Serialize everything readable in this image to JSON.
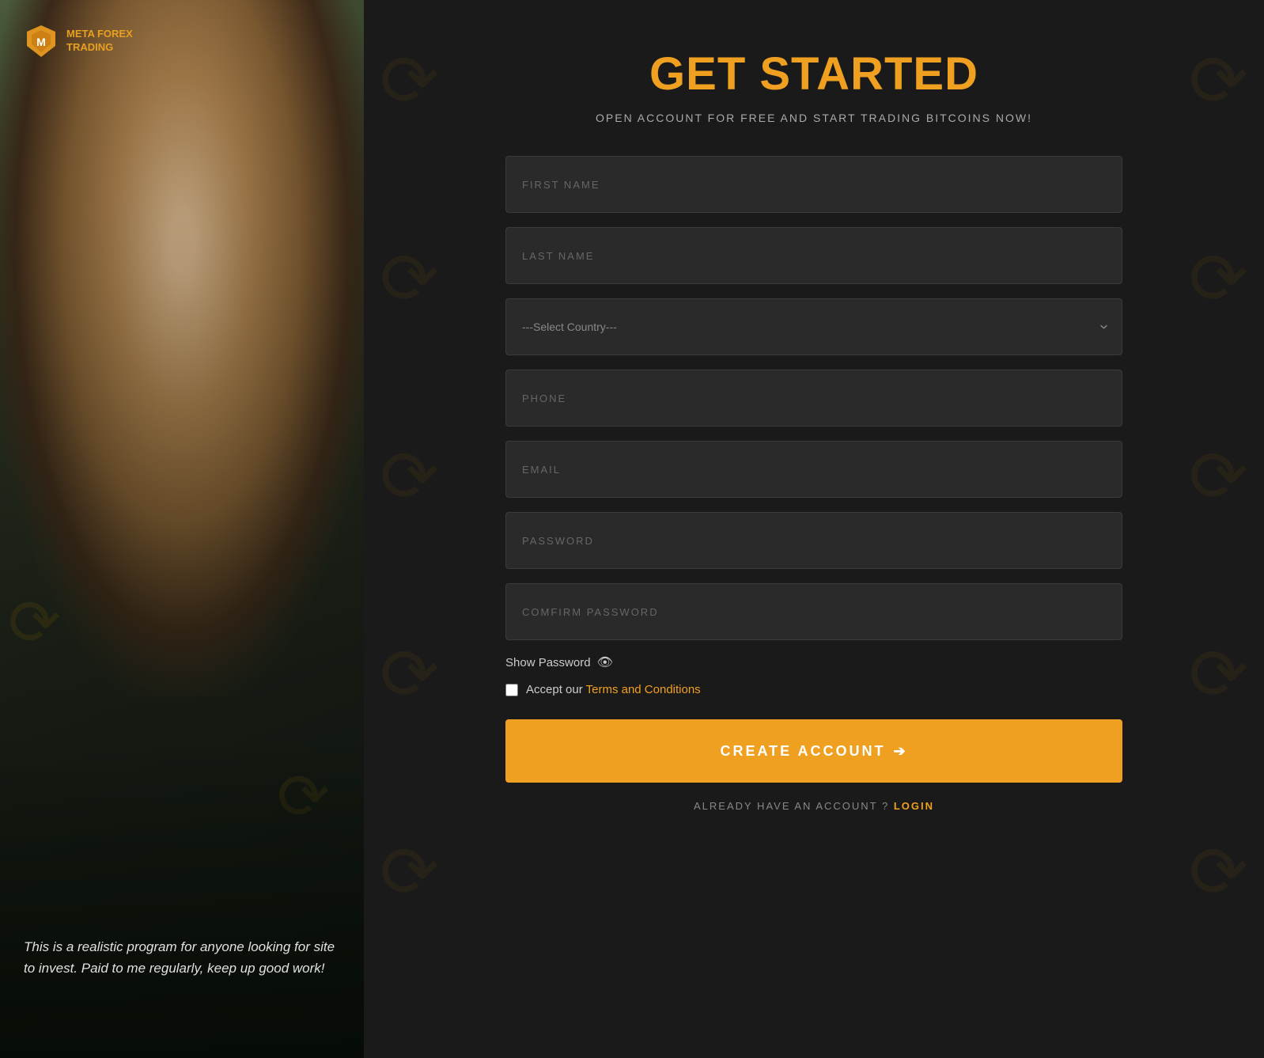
{
  "brand": {
    "name_line1": "META FOREX",
    "name_line2": "TRADING"
  },
  "hero": {
    "title_white": "GET",
    "title_orange": "STARTED",
    "subtitle": "OPEN ACCOUNT FOR FREE AND START TRADING BITCOINS NOW!"
  },
  "form": {
    "first_name_placeholder": "FIRST NAME",
    "last_name_placeholder": "LAST NAME",
    "country_placeholder": "---Select Country---",
    "phone_placeholder": "PHONE",
    "email_placeholder": "EMAIL",
    "password_placeholder": "PASSWORD",
    "confirm_password_placeholder": "COMFIRM PASSWORD",
    "show_password_label": "Show Password",
    "terms_prefix": "Accept our ",
    "terms_link_text": "Terms and Conditions",
    "create_button_label": "CREATE ACCOUNT",
    "already_account_text": "ALREADY HAVE AN ACCOUNT ?",
    "login_link": "LOGIN"
  },
  "testimonial": {
    "text": "This is a realistic program for anyone looking for site to invest. Paid to me regularly, keep up good work!"
  },
  "colors": {
    "orange": "#f0a020",
    "dark_bg": "#1a1a1a",
    "input_bg": "#2a2a2a"
  }
}
